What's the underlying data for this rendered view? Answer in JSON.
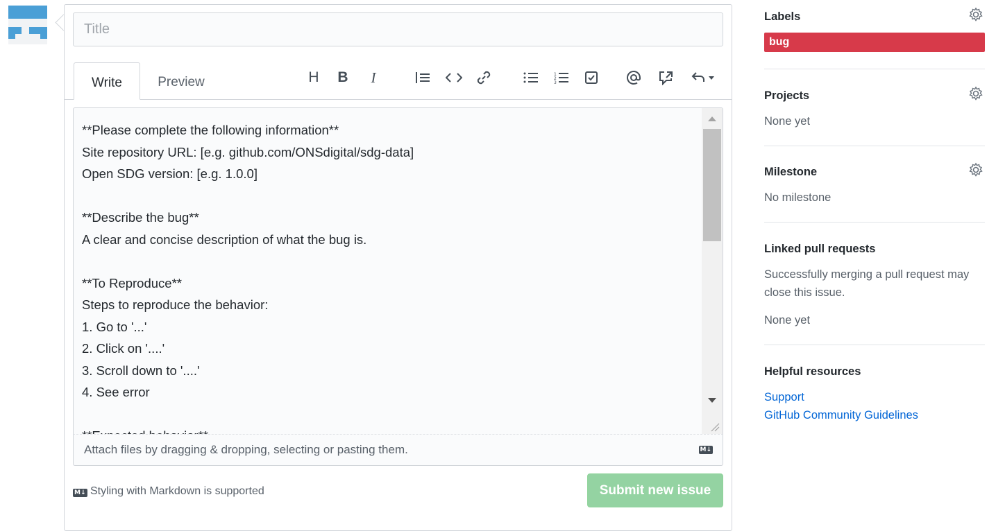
{
  "colors": {
    "label_bug": "#d73a4a",
    "submit_disabled": "#94d3a2",
    "link": "#0366d6"
  },
  "title_input": {
    "placeholder": "Title",
    "value": ""
  },
  "tabs": {
    "write": "Write",
    "preview": "Preview"
  },
  "toolbar": {
    "heading": "H",
    "bold": "B",
    "italic": "I",
    "quote": "quote",
    "code": "<>",
    "link": "link",
    "bullet_list": "bullet-list",
    "numbered_list": "numbered-list",
    "task_list": "task-list",
    "mention": "@",
    "reference": "reference",
    "reply": "reply"
  },
  "editor": {
    "lines": [
      "**Please complete the following information**",
      "Site repository URL: [e.g. github.com/ONSdigital/sdg-data]",
      "Open SDG version: [e.g. 1.0.0]",
      "",
      "**Describe the bug**",
      "A clear and concise description of what the bug is.",
      "",
      "**To Reproduce**",
      "Steps to reproduce the behavior:",
      "1. Go to '...'",
      "2. Click on '....'",
      "3. Scroll down to '....'",
      "4. See error",
      "",
      "**Expected behavior**"
    ]
  },
  "attach": {
    "text": "Attach files by dragging & dropping, selecting or pasting them.",
    "md_badge": "M↓"
  },
  "footer": {
    "styling": "Styling with Markdown is supported",
    "md_badge": "M↓",
    "submit": "Submit new issue"
  },
  "sidebar": {
    "labels": {
      "heading": "Labels",
      "items": [
        "bug"
      ]
    },
    "projects": {
      "heading": "Projects",
      "value": "None yet"
    },
    "milestone": {
      "heading": "Milestone",
      "value": "No milestone"
    },
    "linked_prs": {
      "heading": "Linked pull requests",
      "description": "Successfully merging a pull request may close this issue.",
      "value": "None yet"
    },
    "helpful": {
      "heading": "Helpful resources",
      "links": [
        "Support",
        "GitHub Community Guidelines"
      ]
    }
  }
}
